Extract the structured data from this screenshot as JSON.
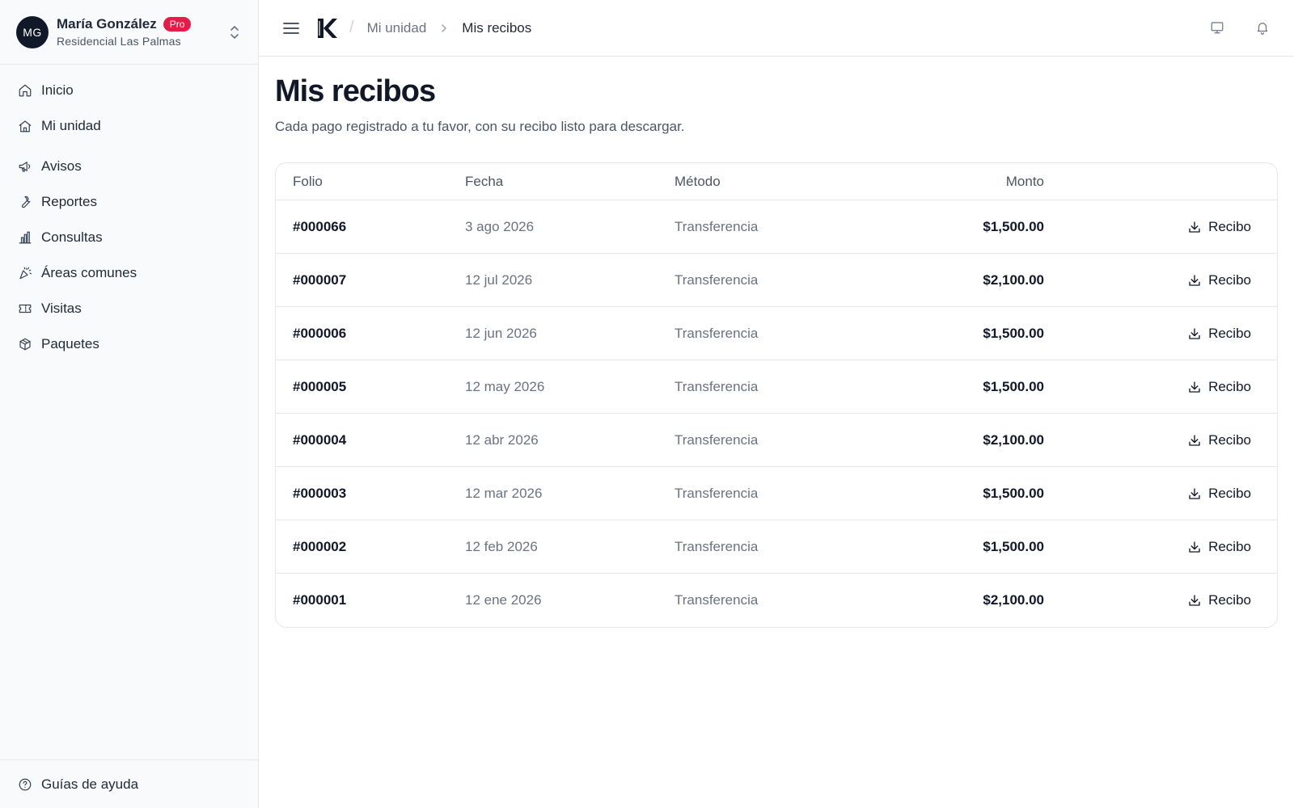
{
  "user": {
    "initials": "MG",
    "name": "María González",
    "badge": "Pro",
    "residence": "Residencial Las Palmas"
  },
  "sidebar": {
    "items": [
      {
        "label": "Inicio",
        "icon": "home-icon"
      },
      {
        "label": "Mi unidad",
        "icon": "house-icon"
      },
      {
        "label": "Avisos",
        "icon": "megaphone-icon"
      },
      {
        "label": "Reportes",
        "icon": "wrench-icon"
      },
      {
        "label": "Consultas",
        "icon": "bar-chart-icon"
      },
      {
        "label": "Áreas comunes",
        "icon": "party-popper-icon"
      },
      {
        "label": "Visitas",
        "icon": "ticket-icon"
      },
      {
        "label": "Paquetes",
        "icon": "package-icon"
      }
    ],
    "footer": {
      "label": "Guías de ayuda",
      "icon": "help-circle-icon"
    }
  },
  "topbar": {
    "breadcrumb": {
      "parent": "Mi unidad",
      "current": "Mis recibos"
    }
  },
  "page": {
    "title": "Mis recibos",
    "subtitle": "Cada pago registrado a tu favor, con su recibo listo para descargar."
  },
  "table": {
    "headers": {
      "folio": "Folio",
      "fecha": "Fecha",
      "metodo": "Método",
      "monto": "Monto"
    },
    "rows": [
      {
        "folio": "#000066",
        "fecha": "3 ago 2026",
        "metodo": "Transferencia",
        "monto": "$1,500.00",
        "action": "Recibo"
      },
      {
        "folio": "#000007",
        "fecha": "12 jul 2026",
        "metodo": "Transferencia",
        "monto": "$2,100.00",
        "action": "Recibo"
      },
      {
        "folio": "#000006",
        "fecha": "12 jun 2026",
        "metodo": "Transferencia",
        "monto": "$1,500.00",
        "action": "Recibo"
      },
      {
        "folio": "#000005",
        "fecha": "12 may 2026",
        "metodo": "Transferencia",
        "monto": "$1,500.00",
        "action": "Recibo"
      },
      {
        "folio": "#000004",
        "fecha": "12 abr 2026",
        "metodo": "Transferencia",
        "monto": "$2,100.00",
        "action": "Recibo"
      },
      {
        "folio": "#000003",
        "fecha": "12 mar 2026",
        "metodo": "Transferencia",
        "monto": "$1,500.00",
        "action": "Recibo"
      },
      {
        "folio": "#000002",
        "fecha": "12 feb 2026",
        "metodo": "Transferencia",
        "monto": "$1,500.00",
        "action": "Recibo"
      },
      {
        "folio": "#000001",
        "fecha": "12 ene 2026",
        "metodo": "Transferencia",
        "monto": "$2,100.00",
        "action": "Recibo"
      }
    ]
  }
}
